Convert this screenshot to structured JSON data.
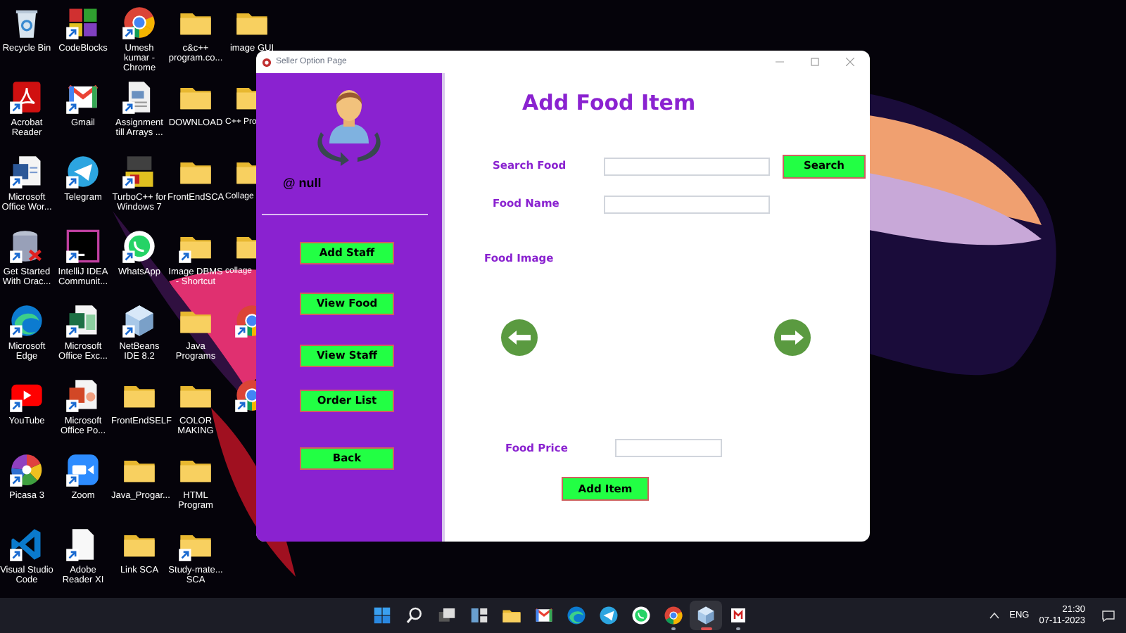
{
  "desktop": {
    "columns": [
      [
        {
          "label": "Recycle Bin",
          "kind": "recycle",
          "shortcut": false
        },
        {
          "label": "Acrobat Reader",
          "kind": "pdf",
          "shortcut": true
        },
        {
          "label": "Microsoft Office Wor...",
          "kind": "word",
          "shortcut": true
        },
        {
          "label": "Get Started With Orac...",
          "kind": "database",
          "shortcut": true
        },
        {
          "label": "Microsoft Edge",
          "kind": "edge",
          "shortcut": true
        },
        {
          "label": "YouTube",
          "kind": "youtube",
          "shortcut": true
        },
        {
          "label": "Picasa 3",
          "kind": "picasa",
          "shortcut": true
        },
        {
          "label": "Visual Studio Code",
          "kind": "vscode",
          "shortcut": true
        }
      ],
      [
        {
          "label": "CodeBlocks",
          "kind": "codeblocks",
          "shortcut": true
        },
        {
          "label": "Gmail",
          "kind": "gmail",
          "shortcut": true
        },
        {
          "label": "Telegram",
          "kind": "telegram",
          "shortcut": true
        },
        {
          "label": "IntelliJ IDEA Communit...",
          "kind": "intellij",
          "shortcut": true
        },
        {
          "label": "Microsoft Office Exc...",
          "kind": "excel",
          "shortcut": true
        },
        {
          "label": "Microsoft Office Po...",
          "kind": "powerpoint",
          "shortcut": true
        },
        {
          "label": "Zoom",
          "kind": "zoom",
          "shortcut": true
        },
        {
          "label": "Adobe Reader XI",
          "kind": "blank",
          "shortcut": true
        }
      ],
      [
        {
          "label": "Umesh kumar - Chrome",
          "kind": "chrome",
          "shortcut": true
        },
        {
          "label": "Assignment till Arrays ...",
          "kind": "document",
          "shortcut": true
        },
        {
          "label": "TurboC++ for Windows 7",
          "kind": "turbo",
          "shortcut": true
        },
        {
          "label": "WhatsApp",
          "kind": "whatsapp",
          "shortcut": true
        },
        {
          "label": "NetBeans IDE 8.2",
          "kind": "netbeans",
          "shortcut": true
        },
        {
          "label": "FrontEndSELF",
          "kind": "folder",
          "shortcut": false
        },
        {
          "label": "Java_Progar...",
          "kind": "folder",
          "shortcut": false
        },
        {
          "label": "Link SCA",
          "kind": "folder",
          "shortcut": false
        }
      ],
      [
        {
          "label": "c&c++ program.co...",
          "kind": "folder",
          "shortcut": false
        },
        {
          "label": "DOWNLOAD",
          "kind": "folder",
          "shortcut": false
        },
        {
          "label": "FrontEndSCA",
          "kind": "folder",
          "shortcut": false
        },
        {
          "label": "Image DBMS - Shortcut",
          "kind": "folder",
          "shortcut": true
        },
        {
          "label": "Java Programs",
          "kind": "folder",
          "shortcut": false
        },
        {
          "label": "COLOR MAKING",
          "kind": "folder",
          "shortcut": false
        },
        {
          "label": "HTML Program",
          "kind": "folder",
          "shortcut": false
        },
        {
          "label": "Study-mate... SCA",
          "kind": "folder",
          "shortcut": true
        }
      ],
      [
        {
          "label": "image GUI",
          "kind": "folder",
          "shortcut": false
        },
        {
          "label": "C++ Pro",
          "kind": "folder",
          "shortcut": false
        },
        {
          "label": "Collage",
          "kind": "folder",
          "shortcut": false
        },
        {
          "label": "collage",
          "kind": "folder",
          "shortcut": false
        },
        {
          "kind": "chrome",
          "shortcut": true
        },
        {
          "kind": "chrome",
          "shortcut": true
        }
      ]
    ]
  },
  "window": {
    "title": "Seller Option Page",
    "user": "@ null",
    "nav_buttons": [
      "Add Staff",
      "View Food",
      "View Staff",
      "Order List",
      "Back"
    ],
    "heading": "Add Food Item",
    "search_label": "Search Food",
    "search_button": "Search",
    "name_label": "Food Name",
    "image_label": "Food Image",
    "price_label": "Food Price",
    "add_button": "Add Item"
  },
  "taskbar": {
    "apps": [
      {
        "kind": "start",
        "running": false,
        "selected": false
      },
      {
        "kind": "search",
        "running": false,
        "selected": false
      },
      {
        "kind": "taskview",
        "running": false,
        "selected": false
      },
      {
        "kind": "widgets",
        "running": false,
        "selected": false
      },
      {
        "kind": "folder",
        "running": false,
        "selected": false
      },
      {
        "kind": "gmail",
        "running": false,
        "selected": false
      },
      {
        "kind": "edge",
        "running": false,
        "selected": false
      },
      {
        "kind": "telegram",
        "running": false,
        "selected": false
      },
      {
        "kind": "whatsapp",
        "running": false,
        "selected": false
      },
      {
        "kind": "chrome",
        "running": true,
        "selected": false
      },
      {
        "kind": "netbeans",
        "running": true,
        "selected": true
      },
      {
        "kind": "javaapp",
        "running": true,
        "selected": false
      }
    ],
    "language": "ENG",
    "time": "21:30",
    "date": "07-11-2023"
  }
}
